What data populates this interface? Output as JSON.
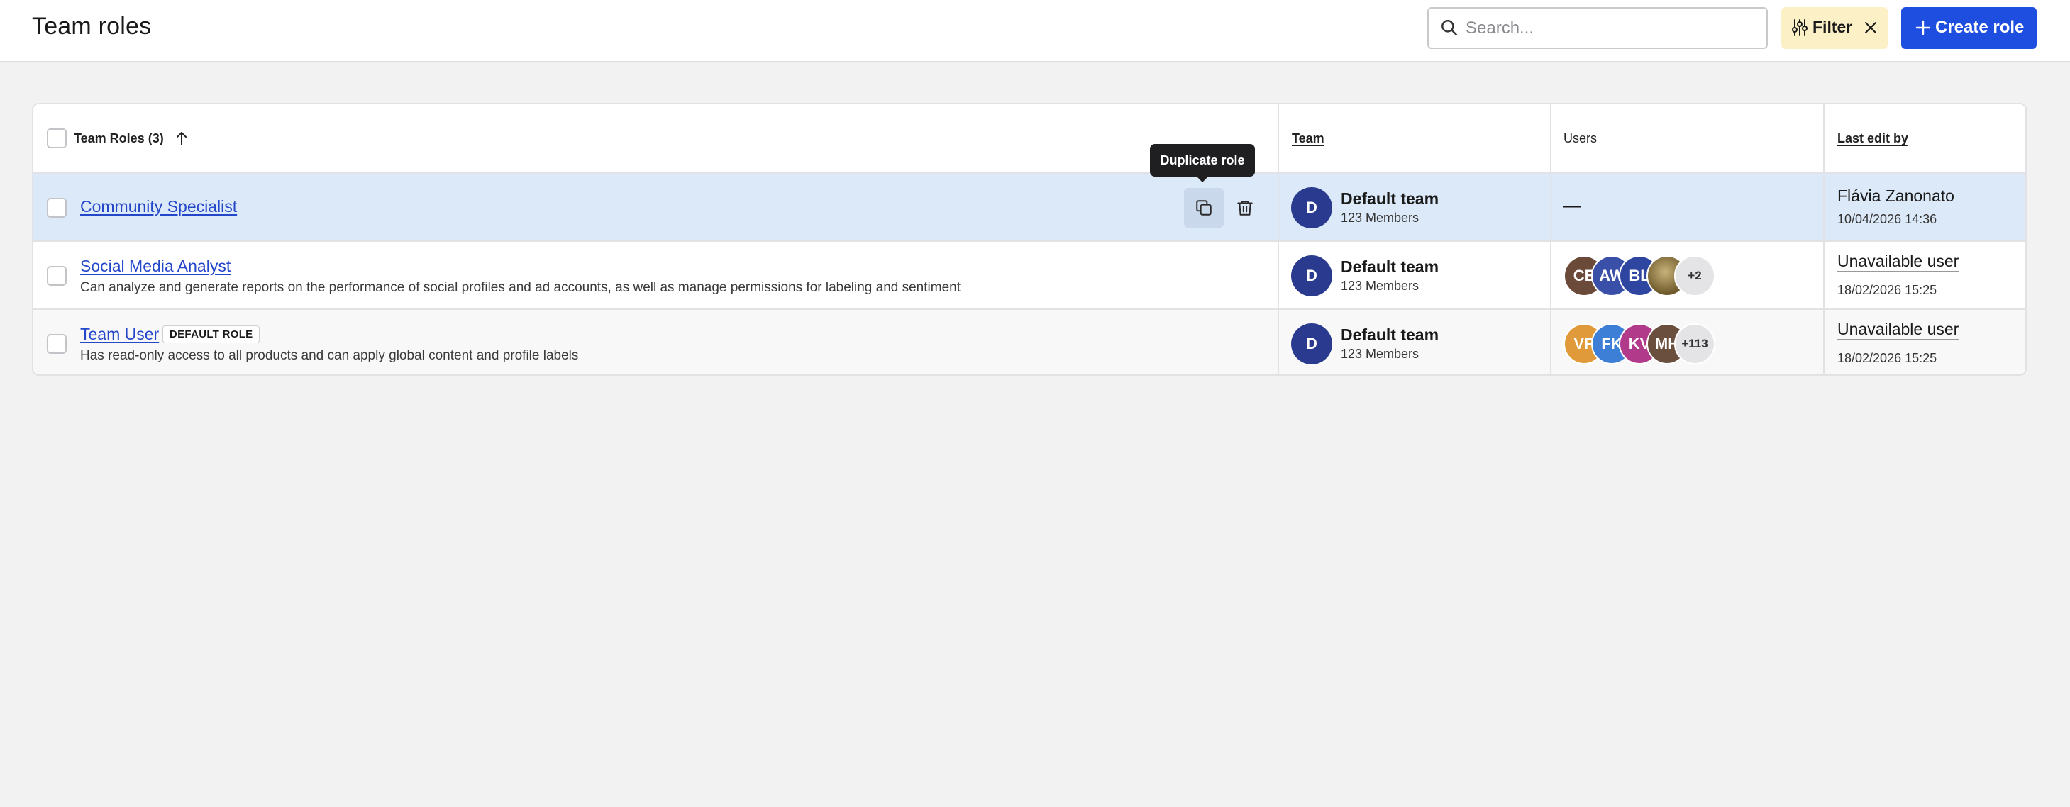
{
  "header": {
    "title": "Team roles",
    "search_placeholder": "Search...",
    "filter_label": "Filter",
    "create_label": "Create role"
  },
  "table": {
    "columns": {
      "roles": "Team Roles (3)",
      "team": "Team",
      "users": "Users",
      "last_edit": "Last edit by"
    },
    "tooltip": "Duplicate role",
    "rows": [
      {
        "name": "Community Specialist",
        "description": "",
        "badge": "",
        "team_initial": "D",
        "team_name": "Default team",
        "team_members": "123 Members",
        "users_empty": "—",
        "users": [],
        "users_more": "",
        "editor": "Flávia Zanonato",
        "edit_date": "10/04/2026 14:36"
      },
      {
        "name": "Social Media Analyst",
        "description": "Can analyze and generate reports on the performance of social profiles and ad accounts, as well as manage permissions for labeling and sentiment",
        "badge": "",
        "team_initial": "D",
        "team_name": "Default team",
        "team_members": "123 Members",
        "users": [
          {
            "initials": "CE",
            "color": "#6b4a3a"
          },
          {
            "initials": "AW",
            "color": "#3a4fa8"
          },
          {
            "initials": "BL",
            "color": "#2f46a0"
          },
          {
            "initials": "",
            "color": "#8a7a3a"
          }
        ],
        "users_more": "+2",
        "editor": "Unavailable user",
        "edit_date": "18/02/2026 15:25"
      },
      {
        "name": "Team User",
        "description": "Has read-only access to all products and can apply global content and profile labels",
        "badge": "DEFAULT ROLE",
        "team_initial": "D",
        "team_name": "Default team",
        "team_members": "123 Members",
        "users": [
          {
            "initials": "VP",
            "color": "#e09a3a"
          },
          {
            "initials": "FK",
            "color": "#3d7fd6"
          },
          {
            "initials": "KV",
            "color": "#b23a8a"
          },
          {
            "initials": "MH",
            "color": "#6a4e3e"
          }
        ],
        "users_more": "+113",
        "editor": "Unavailable user",
        "edit_date": "18/02/2026 15:25"
      }
    ]
  },
  "colors": {
    "primary": "#1d4ee0",
    "filter_bg": "#fbf0c6",
    "hover_row": "#dce9f8",
    "link": "#2447c9"
  },
  "icons": [
    "search-icon",
    "filter-sliders-icon",
    "close-icon",
    "plus-icon",
    "sort-arrow-up-icon",
    "duplicate-icon",
    "trash-icon"
  ]
}
